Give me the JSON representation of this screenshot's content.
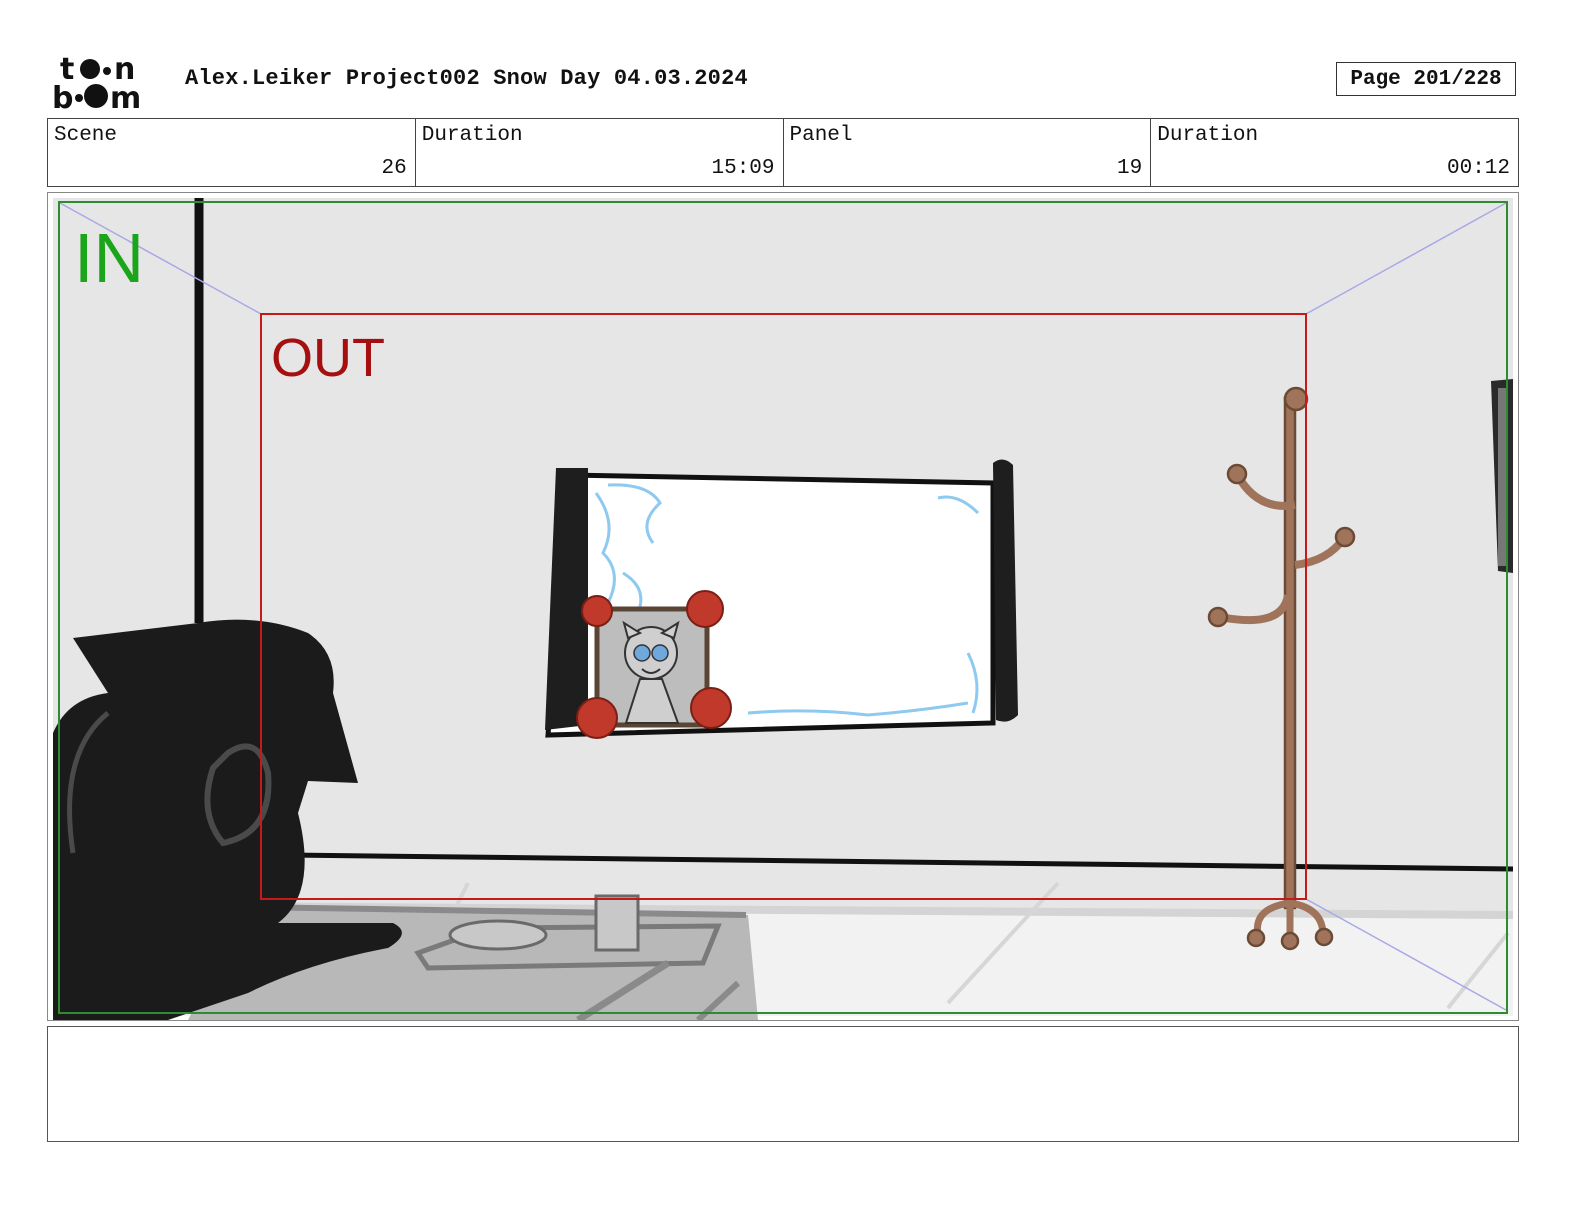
{
  "header": {
    "logo_text_line1": "toon",
    "logo_text_line2": "boom",
    "title": "Alex.Leiker Project002 Snow Day 04.03.2024",
    "page": "Page 201/228"
  },
  "info": {
    "scene_label": "Scene",
    "scene_value": "26",
    "scene_duration_label": "Duration",
    "scene_duration_value": "15:09",
    "panel_label": "Panel",
    "panel_value": "19",
    "panel_duration_label": "Duration",
    "panel_duration_value": "00:12"
  },
  "panel": {
    "in_label": "IN",
    "out_label": "OUT",
    "colors": {
      "in_frame": "#2e8b2e",
      "in_text": "#1aa51a",
      "out_frame": "#c41a1a",
      "out_text": "#a50f0f",
      "wall": "#e6e6e6",
      "coat_rack": "#a0745a",
      "roses": "#c0392b",
      "frost": "#8ec9f0"
    }
  },
  "notes": {
    "text": ""
  }
}
